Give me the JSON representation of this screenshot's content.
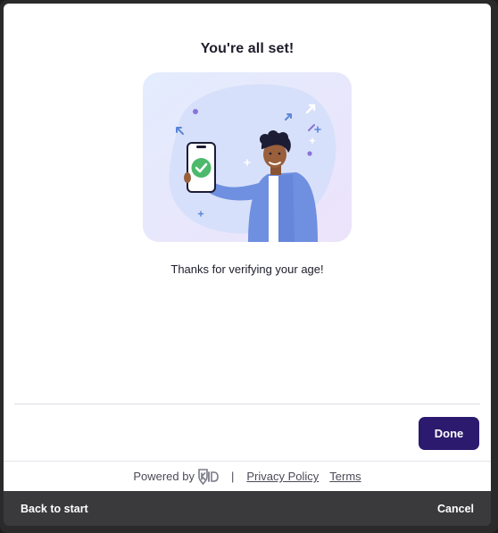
{
  "dialog": {
    "title": "You're all set!",
    "message": "Thanks for verifying your age!",
    "done_label": "Done"
  },
  "footer": {
    "powered_by": "Powered by",
    "brand_logo_text": "KID",
    "separator": "|",
    "privacy_label": "Privacy Policy",
    "terms_label": "Terms"
  },
  "bottom_bar": {
    "back_label": "Back to start",
    "cancel_label": "Cancel"
  },
  "icons": {
    "illustration": "person-holding-phone-with-checkmark-illustration",
    "check": "check-circle-icon",
    "logo": "kid-shield-logo"
  },
  "colors": {
    "primary": "#2b1a6e",
    "check_green": "#4cb96b",
    "illustration_bg": "#dfe6fb",
    "jacket": "#6f8fe0",
    "bottom_bar": "#3a3a3c"
  }
}
